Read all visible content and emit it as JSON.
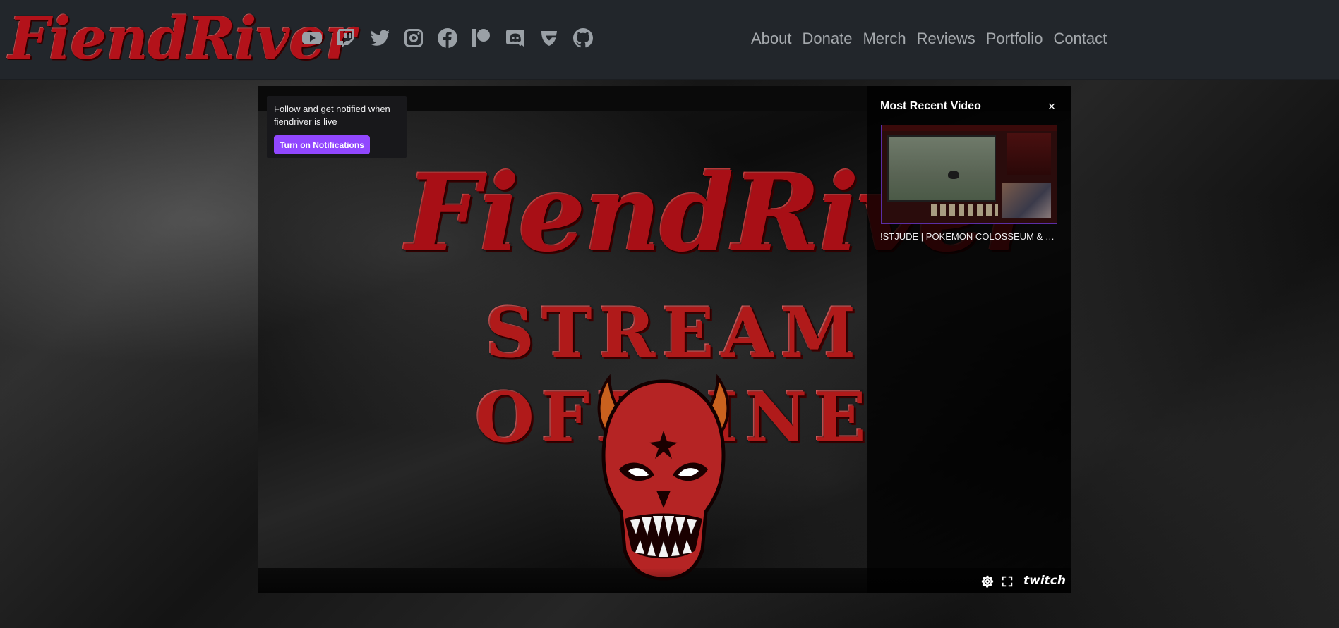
{
  "header": {
    "logo_text": "FiendRiver",
    "social_icons": [
      "youtube-icon",
      "twitch-icon",
      "twitter-icon",
      "instagram-icon",
      "facebook-icon",
      "patreon-icon",
      "discord-icon",
      "guilded-icon",
      "github-icon"
    ],
    "nav": {
      "about": "About",
      "donate": "Donate",
      "merch": "Merch",
      "reviews": "Reviews",
      "portfolio": "Portfolio",
      "contact": "Contact"
    }
  },
  "player": {
    "offline_logo": "FiendRiver",
    "offline_text": "STREAM OFFLINE",
    "notification": {
      "text": "Follow and get notified when fiendriver is live",
      "button": "Turn on Notifications"
    },
    "recent": {
      "title": "Most Recent Video",
      "close": "×",
      "caption": "!STJUDE | POKEMON COLOSSEUM & C..."
    },
    "controls": {
      "settings_icon": "gear-icon",
      "fullscreen_icon": "fullscreen-icon",
      "brand": "twitch"
    }
  },
  "colors": {
    "navbar": "#22262b",
    "nav_text": "#a5a9ad",
    "brand_red": "#b3121a",
    "twitch_purple": "#9147ff"
  }
}
